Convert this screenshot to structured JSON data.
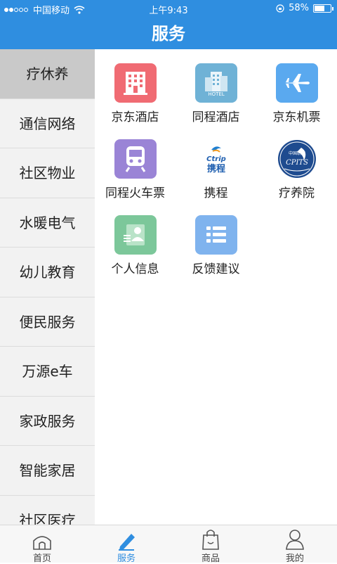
{
  "status": {
    "carrier": "中国移动",
    "time": "上午9:43",
    "battery": "58%"
  },
  "header": {
    "title": "服务"
  },
  "sidebar": {
    "items": [
      {
        "label": "疗休养",
        "active": true
      },
      {
        "label": "通信网络"
      },
      {
        "label": "社区物业"
      },
      {
        "label": "水暖电气"
      },
      {
        "label": "幼儿教育"
      },
      {
        "label": "便民服务"
      },
      {
        "label": "万源e车"
      },
      {
        "label": "家政服务"
      },
      {
        "label": "智能家居"
      },
      {
        "label": "社区医疗"
      }
    ]
  },
  "services": [
    {
      "label": "京东酒店",
      "icon": "hotel-building-icon",
      "color": "#f06b73"
    },
    {
      "label": "同程酒店",
      "icon": "hotel-icon",
      "color": "#6fb2d6"
    },
    {
      "label": "京东机票",
      "icon": "airplane-icon",
      "color": "#5aa9ef"
    },
    {
      "label": "同程火车票",
      "icon": "train-icon",
      "color": "#9a84d6"
    },
    {
      "label": "携程",
      "icon": "ctrip-logo-icon",
      "color": "#ffffff",
      "logo_text": "Ctrip",
      "logo_sub": "携程"
    },
    {
      "label": "疗养院",
      "icon": "cpits-logo-icon",
      "color": "#1e4b8f",
      "logo_text": "CPITS",
      "logo_sub": "中国职工"
    },
    {
      "label": "个人信息",
      "icon": "personal-info-icon",
      "color": "#7cc79a"
    },
    {
      "label": "反馈建议",
      "icon": "feedback-list-icon",
      "color": "#7fb3ee"
    }
  ],
  "tabbar": {
    "items": [
      {
        "label": "首页",
        "icon": "home-icon"
      },
      {
        "label": "服务",
        "icon": "pencil-icon",
        "active": true
      },
      {
        "label": "商品",
        "icon": "shopping-bag-icon"
      },
      {
        "label": "我的",
        "icon": "user-icon"
      }
    ]
  },
  "colors": {
    "accent": "#2f8ee0"
  }
}
